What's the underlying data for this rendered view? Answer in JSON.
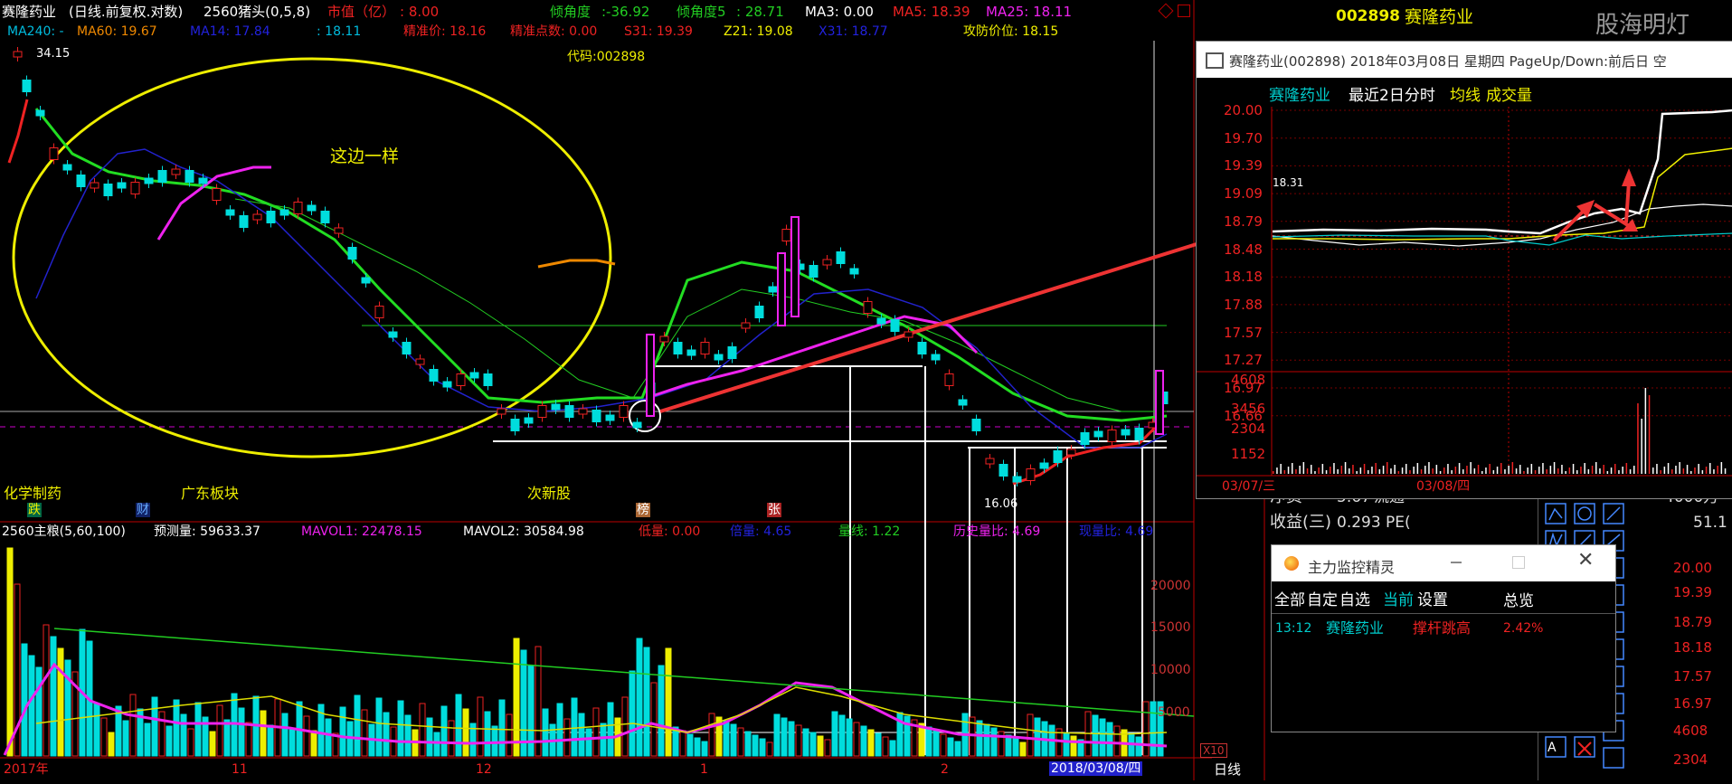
{
  "header": {
    "stock_name": "赛隆药业",
    "chart_type": "(日线.前复权.对数)",
    "indicator": "2560猪头(0,5,8)",
    "market_value_label": "市值（亿）",
    "market_value": ": 8.00",
    "angle_label": "倾角度",
    "angle_value": ":-36.92",
    "angle5_label": "倾角度5",
    "angle5_value": ": 28.71",
    "ma3": "MA3: 0.00",
    "ma5": "MA5: 18.39",
    "ma25": "MA25: 18.11",
    "ma240": "MA240: -",
    "ma60": "MA60: 19.67",
    "ma14": "MA14: 17.84",
    "ma14b": ": 18.11",
    "precise_price": "精准价: 18.16",
    "precise_point": "精准点数: 0.00",
    "s31": "S31: 19.39",
    "z21": "Z21: 19.08",
    "x31": "X31: 18.77",
    "attack_price": "攻防价位: 18.15",
    "code": "代码:002898",
    "high_price": "34.15",
    "low_price": "16.06"
  },
  "annotations": {
    "ellipse_note": "这边一样",
    "tag_chem": "化学制药",
    "tag_gd": "广东板块",
    "tag_new": "次新股",
    "badge_die": "跌",
    "badge_cai": "财",
    "badge_bang": "榜",
    "badge_zhang": "张"
  },
  "volume_header": {
    "title": "2560主粮(5,60,100)",
    "predict": "预测量: 59633.37",
    "mavol1": "MAVOL1: 22478.15",
    "mavol2": "MAVOL2: 30584.98",
    "low": "低量: 0.00",
    "multiple": "倍量: 4.65",
    "line": "量线: 1.22",
    "hist_ratio": "历史量比: 4.69",
    "now_ratio": "现量比: 4.69"
  },
  "volume_axis": [
    "20000",
    "15000",
    "10000",
    "5000",
    "X10"
  ],
  "time_axis": {
    "y2017": "2017年",
    "m11": "11",
    "m12": "12",
    "m1": "1",
    "m2": "2",
    "date": "2018/03/08/四"
  },
  "bottom_tab": "日线",
  "right_panel": {
    "code": "002898",
    "name": "赛隆药业",
    "watermark": "股海明灯",
    "net_label": "净资",
    "net_value": "5.67",
    "flow_label": "流通",
    "flow_value": "4000万",
    "eps_label": "收益(三)",
    "eps_value": "0.293",
    "pe_label": "PE(",
    "pe_value": "51.1",
    "side_prices": [
      "20.00",
      "19.39",
      "18.79",
      "18.18",
      "17.57",
      "16.97",
      "4608",
      "2304"
    ]
  },
  "intraday_popup": {
    "title": "赛隆药业(002898) 2018年03月08日 星期四 PageUp/Down:前后日 空",
    "tab_name": "赛隆药业",
    "tab_days": "最近2日分时",
    "tab_avg": "均线",
    "tab_vol": "成交量",
    "price_axis": [
      "20.00",
      "19.70",
      "19.39",
      "19.09",
      "18.79",
      "18.48",
      "18.18",
      "17.88",
      "17.57",
      "17.27",
      "16.97",
      "16.66"
    ],
    "vol_axis": [
      "4608",
      "3456",
      "2304",
      "1152"
    ],
    "ref_price": "18.31",
    "date1": "03/07/三",
    "date2": "03/08/四"
  },
  "monitor_popup": {
    "title": "主力监控精灵",
    "tabs": [
      "全部",
      "自定",
      "自选",
      "当前",
      "设置"
    ],
    "overview": "总览",
    "row": {
      "time": "13:12",
      "name": "赛隆药业",
      "signal": "撑杆跳高",
      "pct": "2.42%"
    }
  }
}
